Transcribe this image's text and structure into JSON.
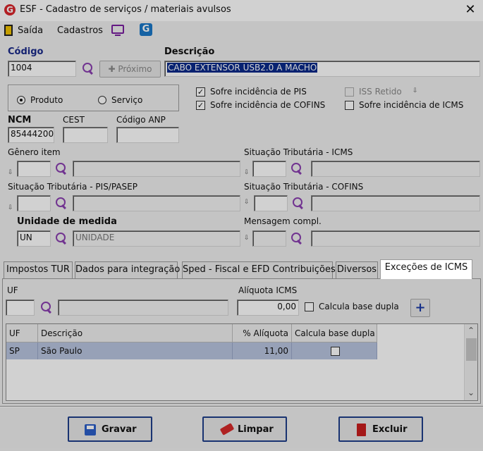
{
  "window": {
    "title": "ESF - Cadastro de serviços / materiais avulsos",
    "logo": "G",
    "close": "✕"
  },
  "menu": {
    "exit": "Saída",
    "records": "Cadastros"
  },
  "codigo": {
    "label": "Código",
    "value": "1004",
    "next_button": "✚ Próximo"
  },
  "descricao": {
    "label": "Descrição",
    "value": "CABO EXTENSOR USB2.0 A MACHO"
  },
  "type": {
    "produto": "Produto",
    "servico": "Serviço",
    "selected": "Produto"
  },
  "checks": {
    "pis": {
      "label": "Sofre incidência de PIS",
      "checked": true
    },
    "cofins": {
      "label": "Sofre incidência de COFINS",
      "checked": true
    },
    "iss": {
      "label": "ISS Retido",
      "checked": false
    },
    "icms": {
      "label": "Sofre incidência de ICMS",
      "checked": false
    }
  },
  "ncm": {
    "label": "NCM",
    "value": "85444200"
  },
  "cest": {
    "label": "CEST",
    "value": ""
  },
  "anp": {
    "label": "Código ANP",
    "value": ""
  },
  "genero": {
    "label": "Gênero item"
  },
  "sit_icms": {
    "label": "Situação Tributária - ICMS"
  },
  "sit_pis": {
    "label": "Situação Tributária - PIS/PASEP"
  },
  "sit_cofins": {
    "label": "Situação Tributária - COFINS"
  },
  "unidade": {
    "label": "Unidade de medida",
    "code": "UN",
    "desc": "UNIDADE"
  },
  "mensagem": {
    "label": "Mensagem compl."
  },
  "tabs": [
    "Impostos TUR",
    "Dados para integração",
    "Sped - Fiscal e EFD Contribuições",
    "Diversos",
    "Exceções de ICMS"
  ],
  "excecoes": {
    "uf_label": "UF",
    "aliquota_label": "Alíquota ICMS",
    "aliquota_value": "0,00",
    "dupla_label": "Calcula base dupla",
    "add": "+"
  },
  "grid": {
    "headers": [
      "UF",
      "Descrição",
      "% Alíquota",
      "Calcula base dupla"
    ],
    "rows": [
      {
        "uf": "SP",
        "desc": "São Paulo",
        "aliq": "11,00"
      }
    ],
    "scroll_up": "⌃",
    "scroll_down": "⌄"
  },
  "buttons": {
    "save": "Gravar",
    "clear": "Limpar",
    "delete": "Excluir"
  },
  "colors": {
    "accent": "#1f3f8a",
    "selection": "#0a2a8a",
    "icon_purple": "#8a3fb0",
    "logo_red": "#d9262c"
  }
}
